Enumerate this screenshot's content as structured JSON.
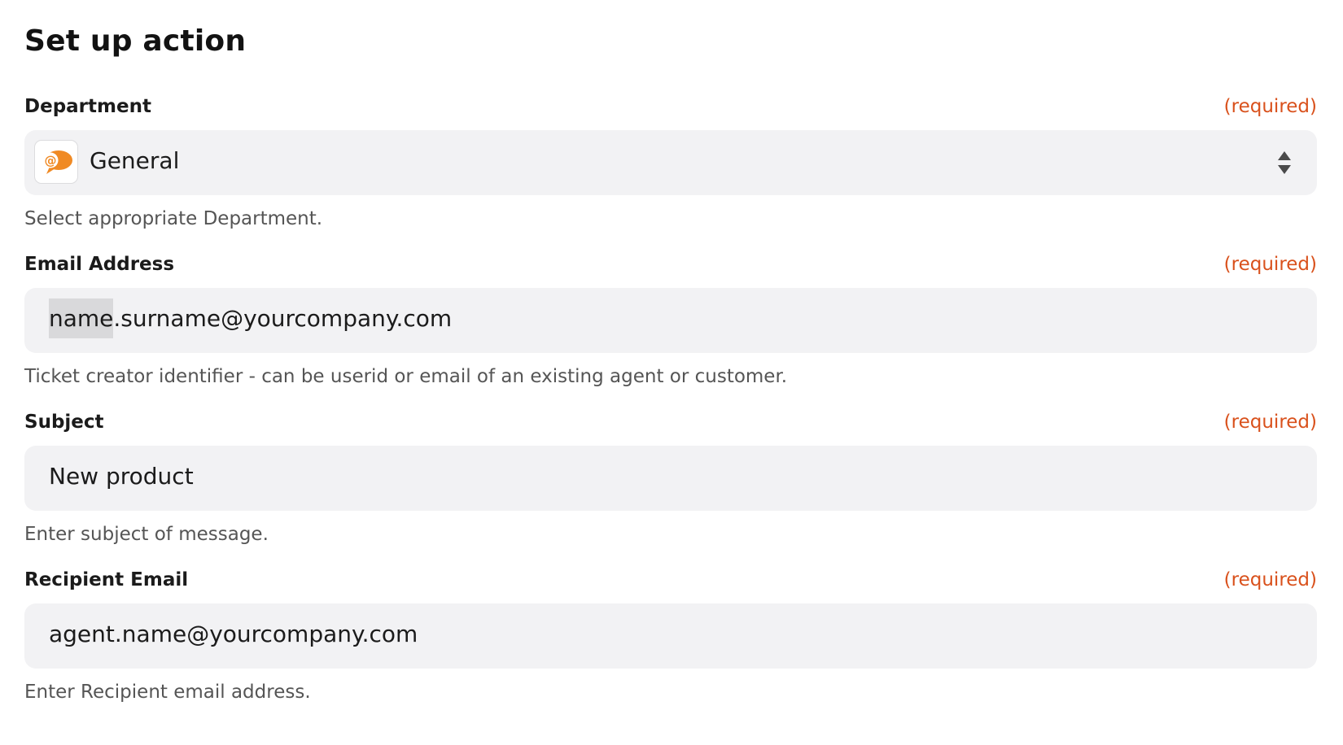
{
  "page": {
    "title": "Set up action"
  },
  "fields": {
    "department": {
      "label": "Department",
      "required": "(required)",
      "value": "General",
      "icon": "chat-bubble-at-icon",
      "help": "Select appropriate Department."
    },
    "email": {
      "label": "Email Address",
      "required": "(required)",
      "value_highlight": "name",
      "value_rest": ".surname@yourcompany.com",
      "help": "Ticket creator identifier - can be userid or email of an existing agent or customer."
    },
    "subject": {
      "label": "Subject",
      "required": "(required)",
      "value": "New product",
      "help": "Enter subject of message."
    },
    "recipient": {
      "label": "Recipient Email",
      "required": "(required)",
      "value": "agent.name@yourcompany.com",
      "help": "Enter Recipient email address."
    }
  },
  "colors": {
    "required": "#d9511c",
    "input_background": "#f2f2f4",
    "icon_orange": "#f08a24"
  }
}
